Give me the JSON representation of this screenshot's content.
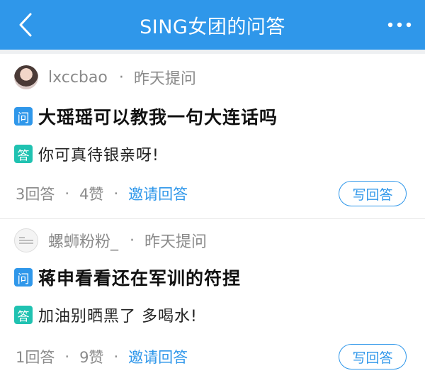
{
  "header": {
    "title": "SING女团的问答",
    "bg_color": "#2f97ea",
    "back_icon": "chevron-left-icon",
    "more_icon": "more-dots-icon"
  },
  "posts": [
    {
      "user": "lxccbao",
      "time": "昨天提问",
      "q_badge": "问",
      "question": "大瑶瑶可以教我一句大连话吗",
      "a_badge": "答",
      "answer": "你可真待银亲呀!",
      "answers_count": "3回答",
      "likes": "4赞",
      "invite": "邀请回答",
      "write_button": "写回答"
    },
    {
      "user": "螺蛳粉粉_",
      "time": "昨天提问",
      "q_badge": "问",
      "question": "蒋申看看还在军训的符捏",
      "a_badge": "答",
      "answer": "加油别晒黑了 多喝水!",
      "answers_count": "1回答",
      "likes": "9赞",
      "invite": "邀请回答",
      "write_button": "写回答"
    }
  ],
  "colors": {
    "accent": "#2f97ea",
    "answer_badge": "#20c2b1"
  }
}
